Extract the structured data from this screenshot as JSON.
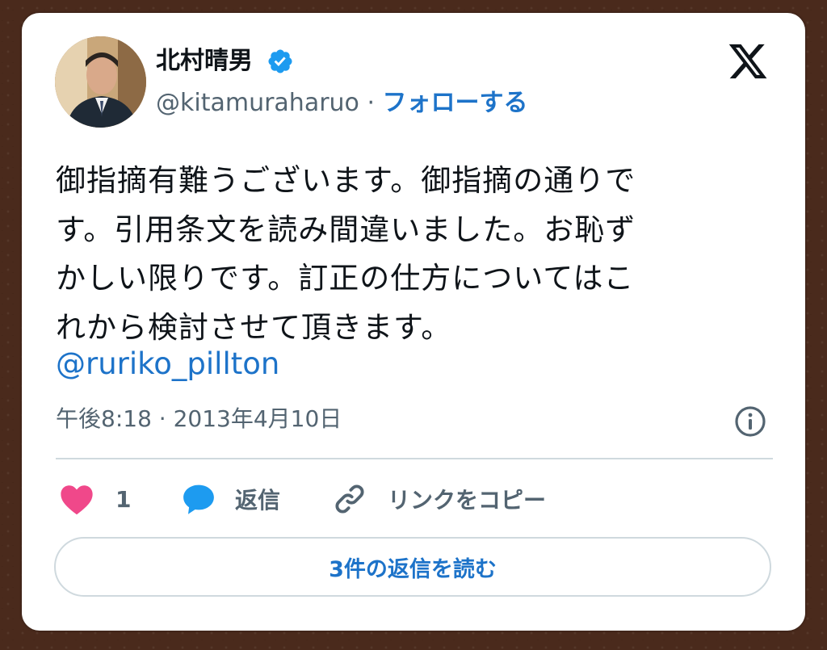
{
  "author": {
    "display_name": "北村晴男",
    "handle": "@kitamuraharuo",
    "separator": " · ",
    "follow_label": "フォローする",
    "verified": true,
    "avatar_icon": "profile-photo"
  },
  "tweet": {
    "lines": [
      "御指摘有難うございます。御指摘の通りで",
      "す。引用条文を読み間違いました。お恥ず",
      "かしい限りです。訂正の仕方については",
      "れから検討させて頂きます。"
    ],
    "line3_tail": "こ",
    "mention": "@ruriko_pillton",
    "timestamp": "午後8:18 · 2013年4月10日"
  },
  "actions": {
    "like_count": "1",
    "reply_label": "返信",
    "copy_link_label": "リンクをコピー"
  },
  "read_replies_label": "3件の返信を読む",
  "colors": {
    "accent": "#1d73c9",
    "like": "#f0488a",
    "reply_bubble": "#1d9bf0",
    "muted": "#536471",
    "text": "#0f1419",
    "background": "#4a2a1c"
  }
}
